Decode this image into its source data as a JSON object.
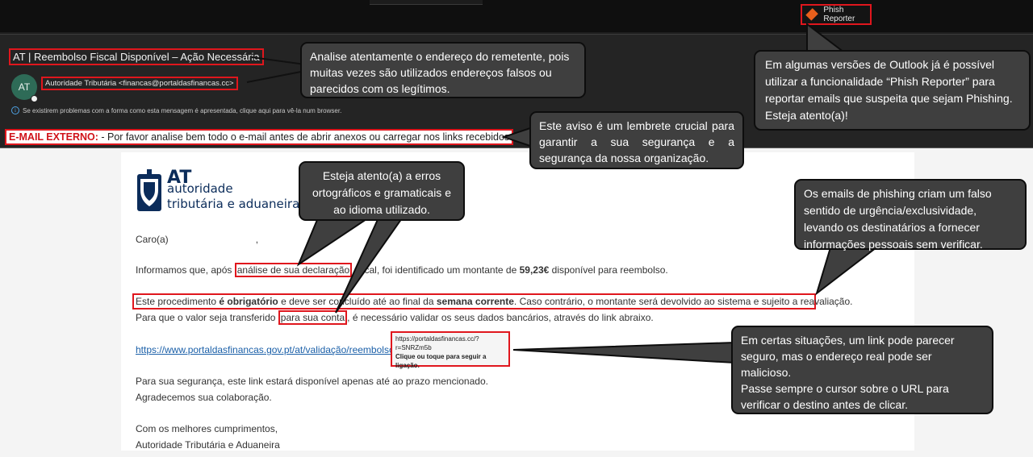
{
  "toolbar": {
    "phish_reporter_label": "Phish Reporter",
    "phish_icon": "phish-reporter-icon"
  },
  "email": {
    "subject": "AT | Reembolso Fiscal Disponível – Ação Necessária",
    "avatar_initials": "AT",
    "sender": "Autoridade Tributária <financas@portaldasfinancas.cc>",
    "info_bar": "Se existirem problemas com a forma como esta mensagem é apresentada, clique aqui para vê-la num browser.",
    "external_label": "E-MAIL EXTERNO:",
    "external_text": " - Por favor analise bem todo o e-mail antes de abrir anexos ou carregar nos links recebidos"
  },
  "body": {
    "logo_line1": "AT",
    "logo_line2": "autoridade",
    "logo_line3": "tributária e aduaneira",
    "greeting": "Caro(a)",
    "greeting_comma": ",",
    "p1_a": "Informamos que, após ",
    "p1_hl": "análise de sua declaração",
    "p1_b": " fiscal, foi identificado um montante de ",
    "p1_amount": "59,23€",
    "p1_c": " disponível para reembolso.",
    "p2_a": "Este procedimento ",
    "p2_b1": "é obrigatório",
    "p2_c": " e deve ser concluído até ao final da ",
    "p2_b2": "semana corrente",
    "p2_d": ". Caso contrário, o montante será devolvido ao sistema e sujeito a reavaliação.",
    "p3_a": "Para que o valor seja transferido ",
    "p3_hl": "para sua conta",
    "p3_b": ", é necessário validar os seus dados bancários, através do link abraixo.",
    "link": "https://www.portaldasfinancas.gov.pt/at/validação/reembolso/",
    "tooltip_url1": "https://portaldasfinancas.cc/?",
    "tooltip_url2": "r=SNRZm5b",
    "tooltip_action": "Clique ou toque para seguir a ligação.",
    "p4": "Para sua segurança, este link estará disponível apenas até ao prazo mencionado.",
    "p5": "Agradecemos sua colaboração.",
    "closing": "Com os melhores cumprimentos,",
    "signature": "Autoridade Tributária e Aduaneira"
  },
  "callouts": {
    "sender": "Analise atentamente o endereço do remetente, pois muitas vezes são utilizados endereços falsos ou parecidos com os legítimos.",
    "phish_reporter": "Em algumas versões de Outlook já é possível utilizar a funcionalidade “Phish Reporter” para reportar emails que suspeita que sejam Phishing. Esteja atento(a)!",
    "external": "Este aviso é um lembrete crucial para garantir a sua segurança e a segurança da nossa organização.",
    "language": "Esteja atento(a) a erros ortográficos e gramaticais e ao idioma utilizado.",
    "urgency": "Os emails de phishing criam um falso sentido de urgência/exclusividade, levando os destinatários a fornecer informações pessoais sem verificar.",
    "link_line1": "Em certas situações, um link pode parecer seguro, mas o endereço real pode ser malicioso.",
    "link_line2": "Passe sempre o cursor sobre o URL para verificar o destino antes de clicar."
  },
  "colors": {
    "highlight_red": "#e0161d",
    "callout_bg": "#3f3f3f",
    "external_label": "#d01219",
    "link_blue": "#1a5fa8",
    "avatar_green": "#2e6b57"
  }
}
